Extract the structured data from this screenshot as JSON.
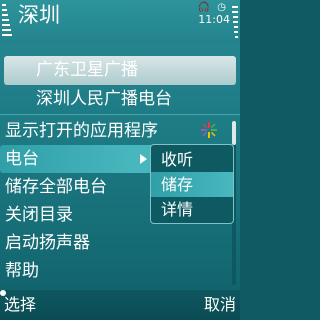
{
  "status_bar": {
    "title": "深圳",
    "clock": "11:04",
    "status_icons": "🎧 ◷"
  },
  "background_list": {
    "items": [
      {
        "label": "广东卫星广播",
        "selected": true
      },
      {
        "label": "深圳人民广播电台",
        "selected": false
      }
    ]
  },
  "options_menu": {
    "items": [
      {
        "label": "显示打开的应用程序"
      },
      {
        "label": "电台",
        "highlighted": true,
        "has_submenu": true
      },
      {
        "label": "储存全部电台"
      },
      {
        "label": "关闭目录"
      },
      {
        "label": "启动扬声器"
      },
      {
        "label": "帮助"
      }
    ],
    "star_icon_colors": [
      "#e23d3d",
      "#4caf50",
      "#f2c200",
      "#9b59b6"
    ]
  },
  "submenu": {
    "items": [
      {
        "label": "收听"
      },
      {
        "label": "储存",
        "highlighted": true
      },
      {
        "label": "详情"
      }
    ]
  },
  "softkeys": {
    "left": "选择",
    "right": "取消"
  }
}
